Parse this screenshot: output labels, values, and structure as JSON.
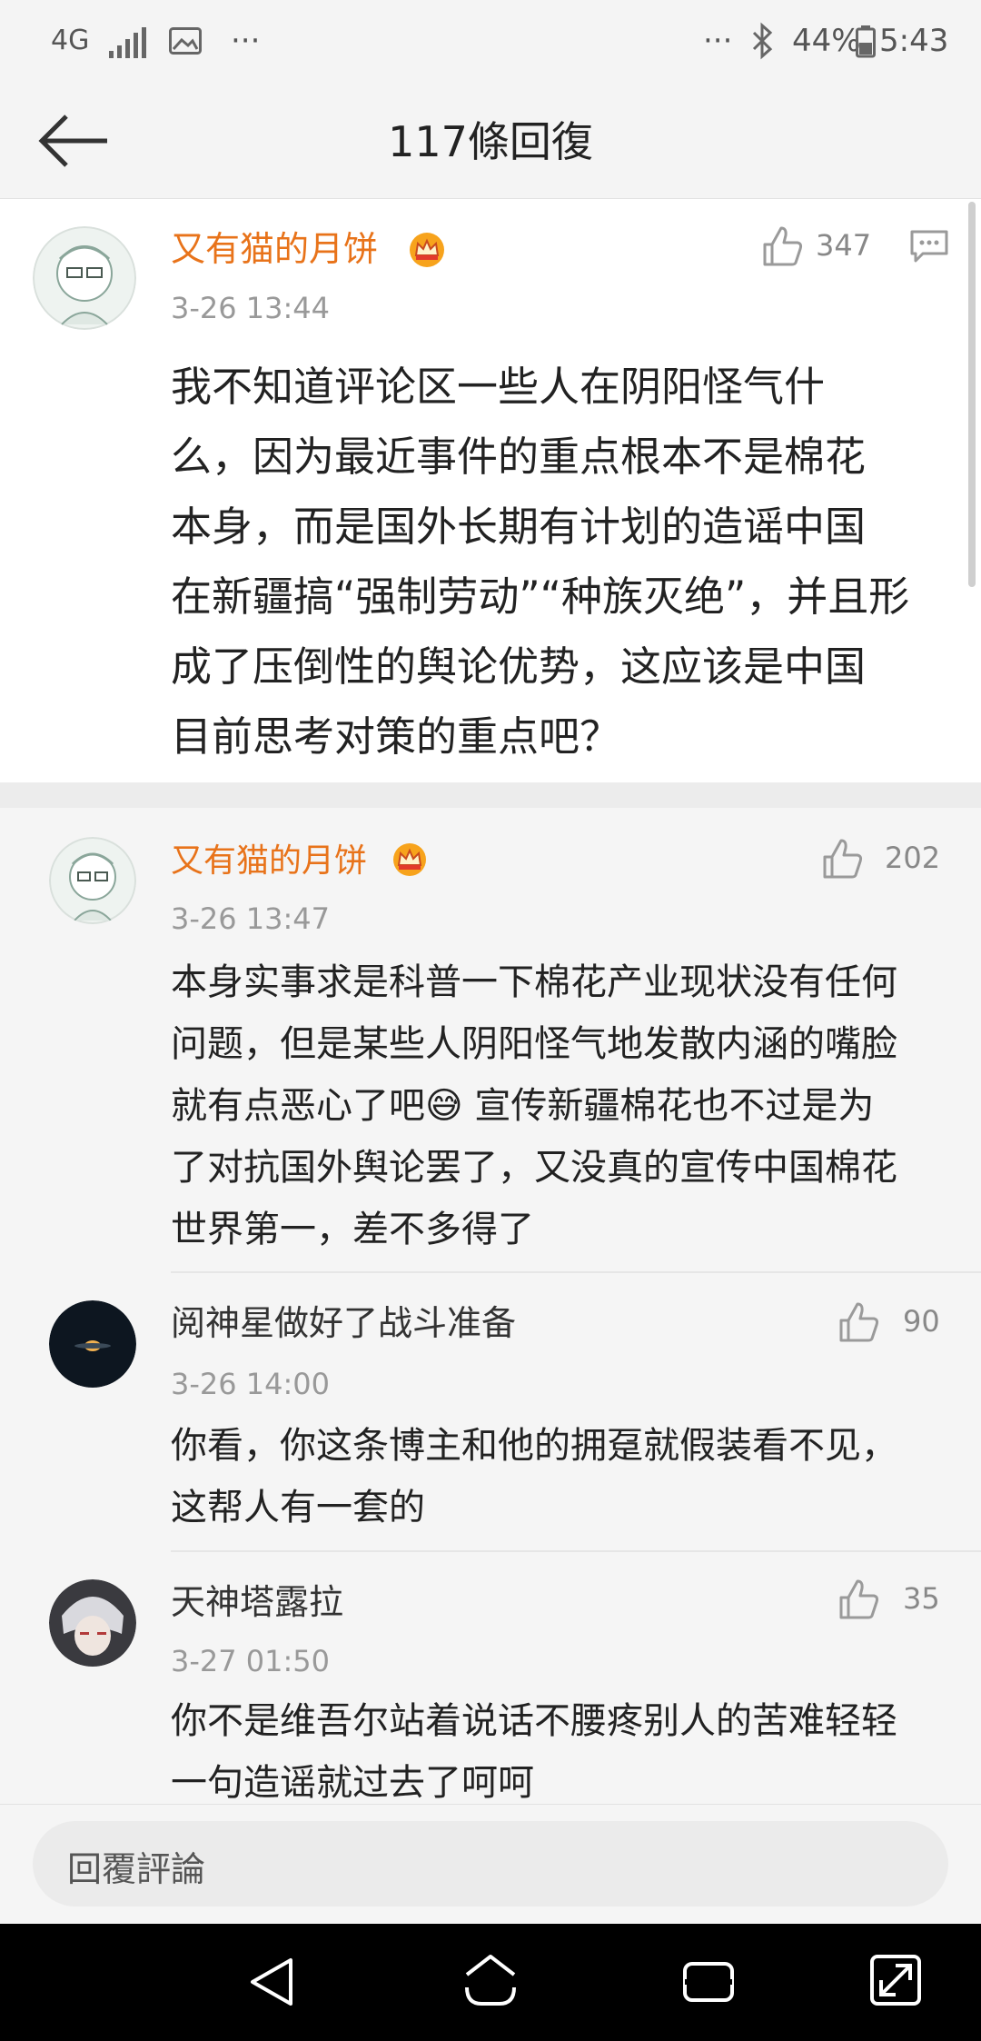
{
  "status_bar": {
    "network": "4G",
    "more_left": "···",
    "more_right": "···",
    "battery": "44%",
    "time": "5:43"
  },
  "header": {
    "title": "117條回復"
  },
  "main_comment": {
    "username": "又有猫的月饼",
    "time": "3-26 13:44",
    "likes": "347",
    "text_lines": [
      "我不知道评论区一些人在阴阳怪气什",
      "么，因为最近事件的重点根本不是棉花",
      "本身，而是国外长期有计划的造谣中国",
      "在新疆搞“强制劳动”“种族灭绝”，并且形",
      "成了压倒性的舆论优势，这应该是中国",
      "目前思考对策的重点吧？"
    ]
  },
  "replies": [
    {
      "username": "又有猫的月饼",
      "time": "3-26 13:47",
      "likes": "202",
      "text_lines": [
        "本身实事求是科普一下棉花产业现状没有任何",
        "问题，但是某些人阴阳怪气地发散内涵的嘴脸",
        "就有点恶心了吧😅 宣传新疆棉花也不过是为",
        "了对抗国外舆论罢了，又没真的宣传中国棉花",
        "世界第一，差不多得了"
      ]
    },
    {
      "username": "阅神星做好了战斗准备",
      "time": "3-26 14:00",
      "likes": "90",
      "text_lines": [
        "你看，你这条博主和他的拥趸就假装看不见，",
        "这帮人有一套的"
      ]
    },
    {
      "username": "天神塔露拉",
      "time": "3-27 01:50",
      "likes": "35",
      "text_lines": [
        "你不是维吾尔站着说话不腰疼别人的苦难轻轻",
        "一句造谣就过去了呵呵"
      ]
    }
  ],
  "reply_bar": {
    "placeholder": "回覆評論"
  },
  "icons": {
    "vip_crown": "crown-icon",
    "like": "thumbs-up-icon",
    "comment": "comment-icon",
    "back": "back-arrow-icon"
  },
  "colors": {
    "vip_username": "#e8731a",
    "background": "#ffffff",
    "secondary_bg": "#f4f4f4",
    "navbar": "#000000"
  }
}
